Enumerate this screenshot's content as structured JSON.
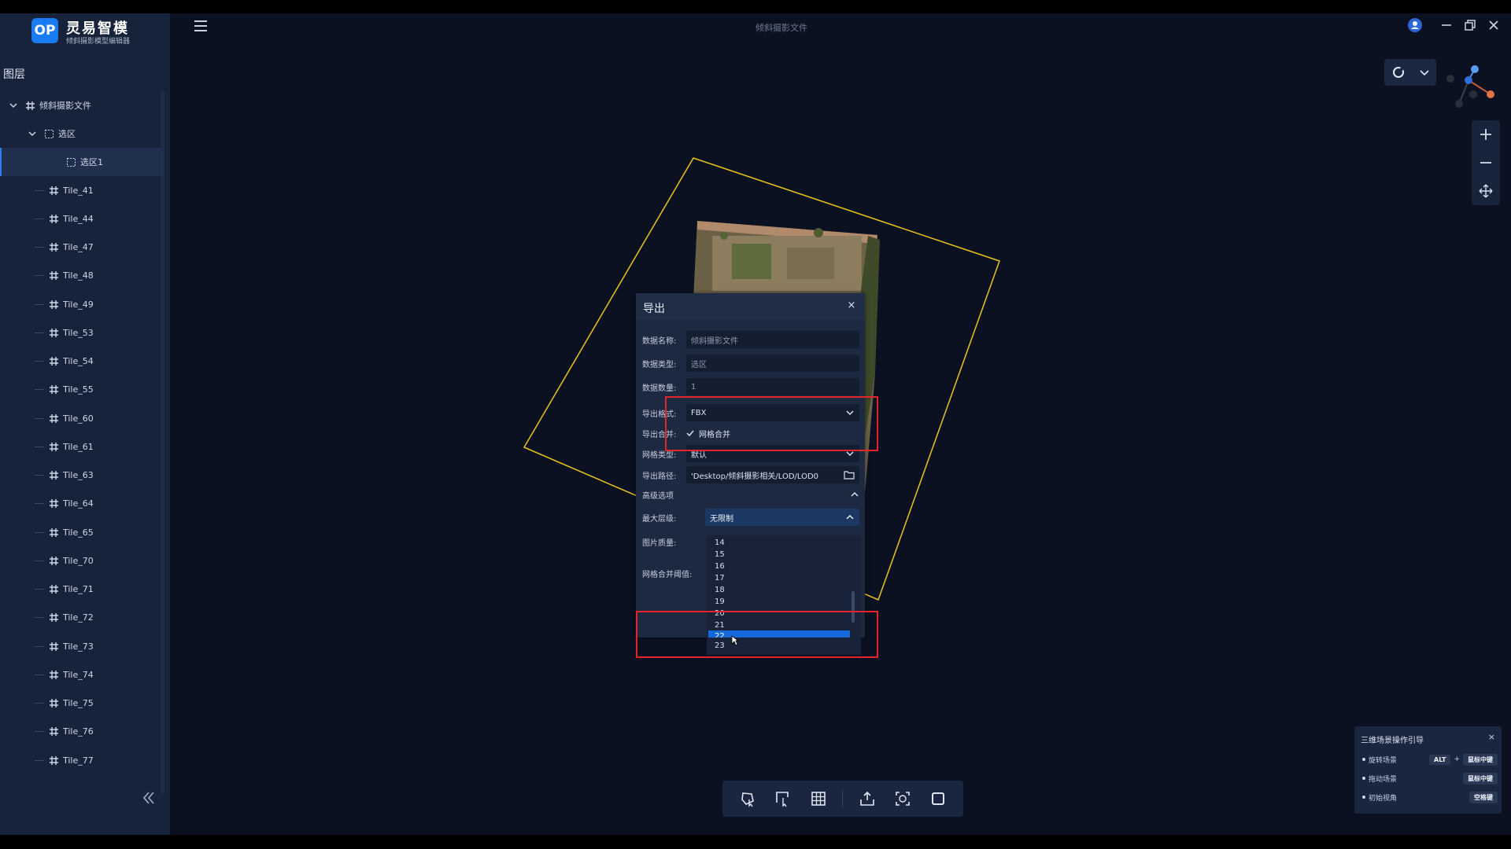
{
  "app": {
    "logo_badge": "OP",
    "logo_title": "灵易智模",
    "logo_subtitle": "倾斜摄影模型编辑器",
    "doc_title": "倾斜摄影文件"
  },
  "sidebar": {
    "title": "图层",
    "root": "倾斜摄影文件",
    "group": "选区",
    "selected_item": "选区1",
    "tiles": [
      "Tile_41",
      "Tile_44",
      "Tile_47",
      "Tile_48",
      "Tile_49",
      "Tile_53",
      "Tile_54",
      "Tile_55",
      "Tile_60",
      "Tile_61",
      "Tile_63",
      "Tile_64",
      "Tile_65",
      "Tile_70",
      "Tile_71",
      "Tile_72",
      "Tile_73",
      "Tile_74",
      "Tile_75",
      "Tile_76",
      "Tile_77"
    ]
  },
  "dialog": {
    "title": "导出",
    "close": "×",
    "fields": {
      "name_label": "数据名称:",
      "name_value": "倾斜摄影文件",
      "type_label": "数据类型:",
      "type_value": "选区",
      "count_label": "数据数量:",
      "count_value": "1",
      "format_label": "导出格式:",
      "format_value": "FBX",
      "merge_label": "导出合并:",
      "merge_check": "网格合并",
      "mesh_label": "网格类型:",
      "mesh_value": "默认",
      "path_label": "导出路径:",
      "path_value": "'Desktop/倾斜摄影相关/LOD/LOD0"
    },
    "advanced": {
      "title": "高级选项",
      "max_level_label": "最大层级:",
      "max_level_value": "无限制",
      "image_quality_label": "图片质量:",
      "merge_threshold_label": "网格合并阈值:"
    },
    "dropdown_options": [
      "14",
      "15",
      "16",
      "17",
      "18",
      "19",
      "20",
      "21",
      "22",
      "23"
    ],
    "dropdown_selected": "22"
  },
  "guide": {
    "title": "三维场景操作引导",
    "close": "×",
    "rows": [
      {
        "label": "旋转场景",
        "key1": "ALT",
        "plus": "+",
        "key2": "鼠标中键"
      },
      {
        "label": "拖动场景",
        "key2": "鼠标中键"
      },
      {
        "label": "初始视角",
        "key2": "空格键"
      }
    ]
  },
  "colors": {
    "accent": "#1a7cf5",
    "selection_box": "#e8c51c",
    "highlight": "#e5232a",
    "dropdown_selected": "#1468d9"
  }
}
